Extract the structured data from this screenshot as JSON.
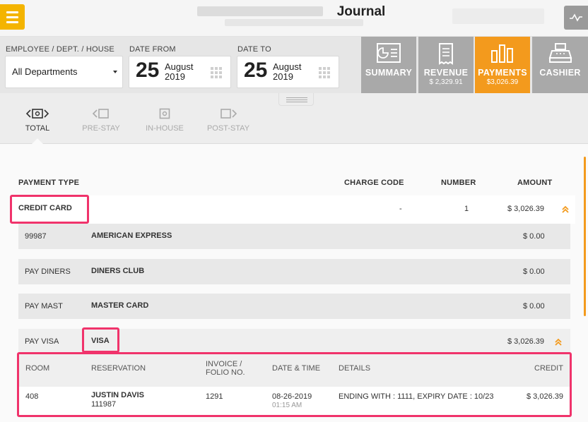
{
  "header": {
    "title": "Journal"
  },
  "filters": {
    "employee_label": "EMPLOYEE / DEPT. / HOUSE",
    "employee_value": "All Departments",
    "date_from_label": "DATE FROM",
    "date_from_day": "25",
    "date_from_month": "August",
    "date_from_year": "2019",
    "date_to_label": "DATE TO",
    "date_to_day": "25",
    "date_to_month": "August",
    "date_to_year": "2019"
  },
  "tabs": [
    {
      "label": "SUMMARY",
      "sub": "",
      "active": false
    },
    {
      "label": "REVENUE",
      "sub": "$ 2,329.91",
      "active": false
    },
    {
      "label": "PAYMENTS",
      "sub": "$3,026.39",
      "active": true
    },
    {
      "label": "CASHIER",
      "sub": "",
      "active": false
    }
  ],
  "stay_tabs": [
    {
      "label": "TOTAL",
      "active": true
    },
    {
      "label": "PRE-STAY",
      "active": false
    },
    {
      "label": "IN-HOUSE",
      "active": false
    },
    {
      "label": "POST-STAY",
      "active": false
    }
  ],
  "table": {
    "headers": {
      "payment_type": "PAYMENT TYPE",
      "charge_code": "CHARGE CODE",
      "number": "NUMBER",
      "amount": "AMOUNT"
    },
    "group": {
      "name": "CREDIT CARD",
      "charge_code": "-",
      "number": "1",
      "amount": "$ 3,026.39"
    },
    "items": [
      {
        "code": "99987",
        "name": "AMERICAN EXPRESS",
        "amount": "$ 0.00"
      },
      {
        "code": "PAY DINERS",
        "name": "DINERS CLUB",
        "amount": "$ 0.00"
      },
      {
        "code": "PAY MAST",
        "name": "MASTER CARD",
        "amount": "$ 0.00"
      },
      {
        "code": "PAY VISA",
        "name": "VISA",
        "amount": "$ 3,026.39"
      }
    ],
    "detail": {
      "headers": {
        "room": "ROOM",
        "reservation": "RESERVATION",
        "invoice_1": "INVOICE /",
        "invoice_2": "FOLIO NO.",
        "datetime": "DATE & TIME",
        "details": "DETAILS",
        "credit": "CREDIT"
      },
      "row": {
        "room": "408",
        "guest": "JUSTIN DAVIS",
        "reservation_no": "111987",
        "invoice": "1291",
        "date": "08-26-2019",
        "time": "01:15 AM",
        "details": "ENDING WITH : 1111, EXPIRY DATE : 10/23",
        "credit": "$ 3,026.39"
      }
    }
  },
  "colors": {
    "accent": "#f39a1d",
    "menu": "#f4b400",
    "highlight": "#f0336b",
    "tab_inactive": "#a9a9a9"
  },
  "icons": {
    "menu": "hamburger-icon",
    "activity": "activity-icon",
    "summary": "summary-icon",
    "revenue": "receipt-icon",
    "payments": "bar-chart-icon",
    "cashier": "cash-register-icon"
  }
}
